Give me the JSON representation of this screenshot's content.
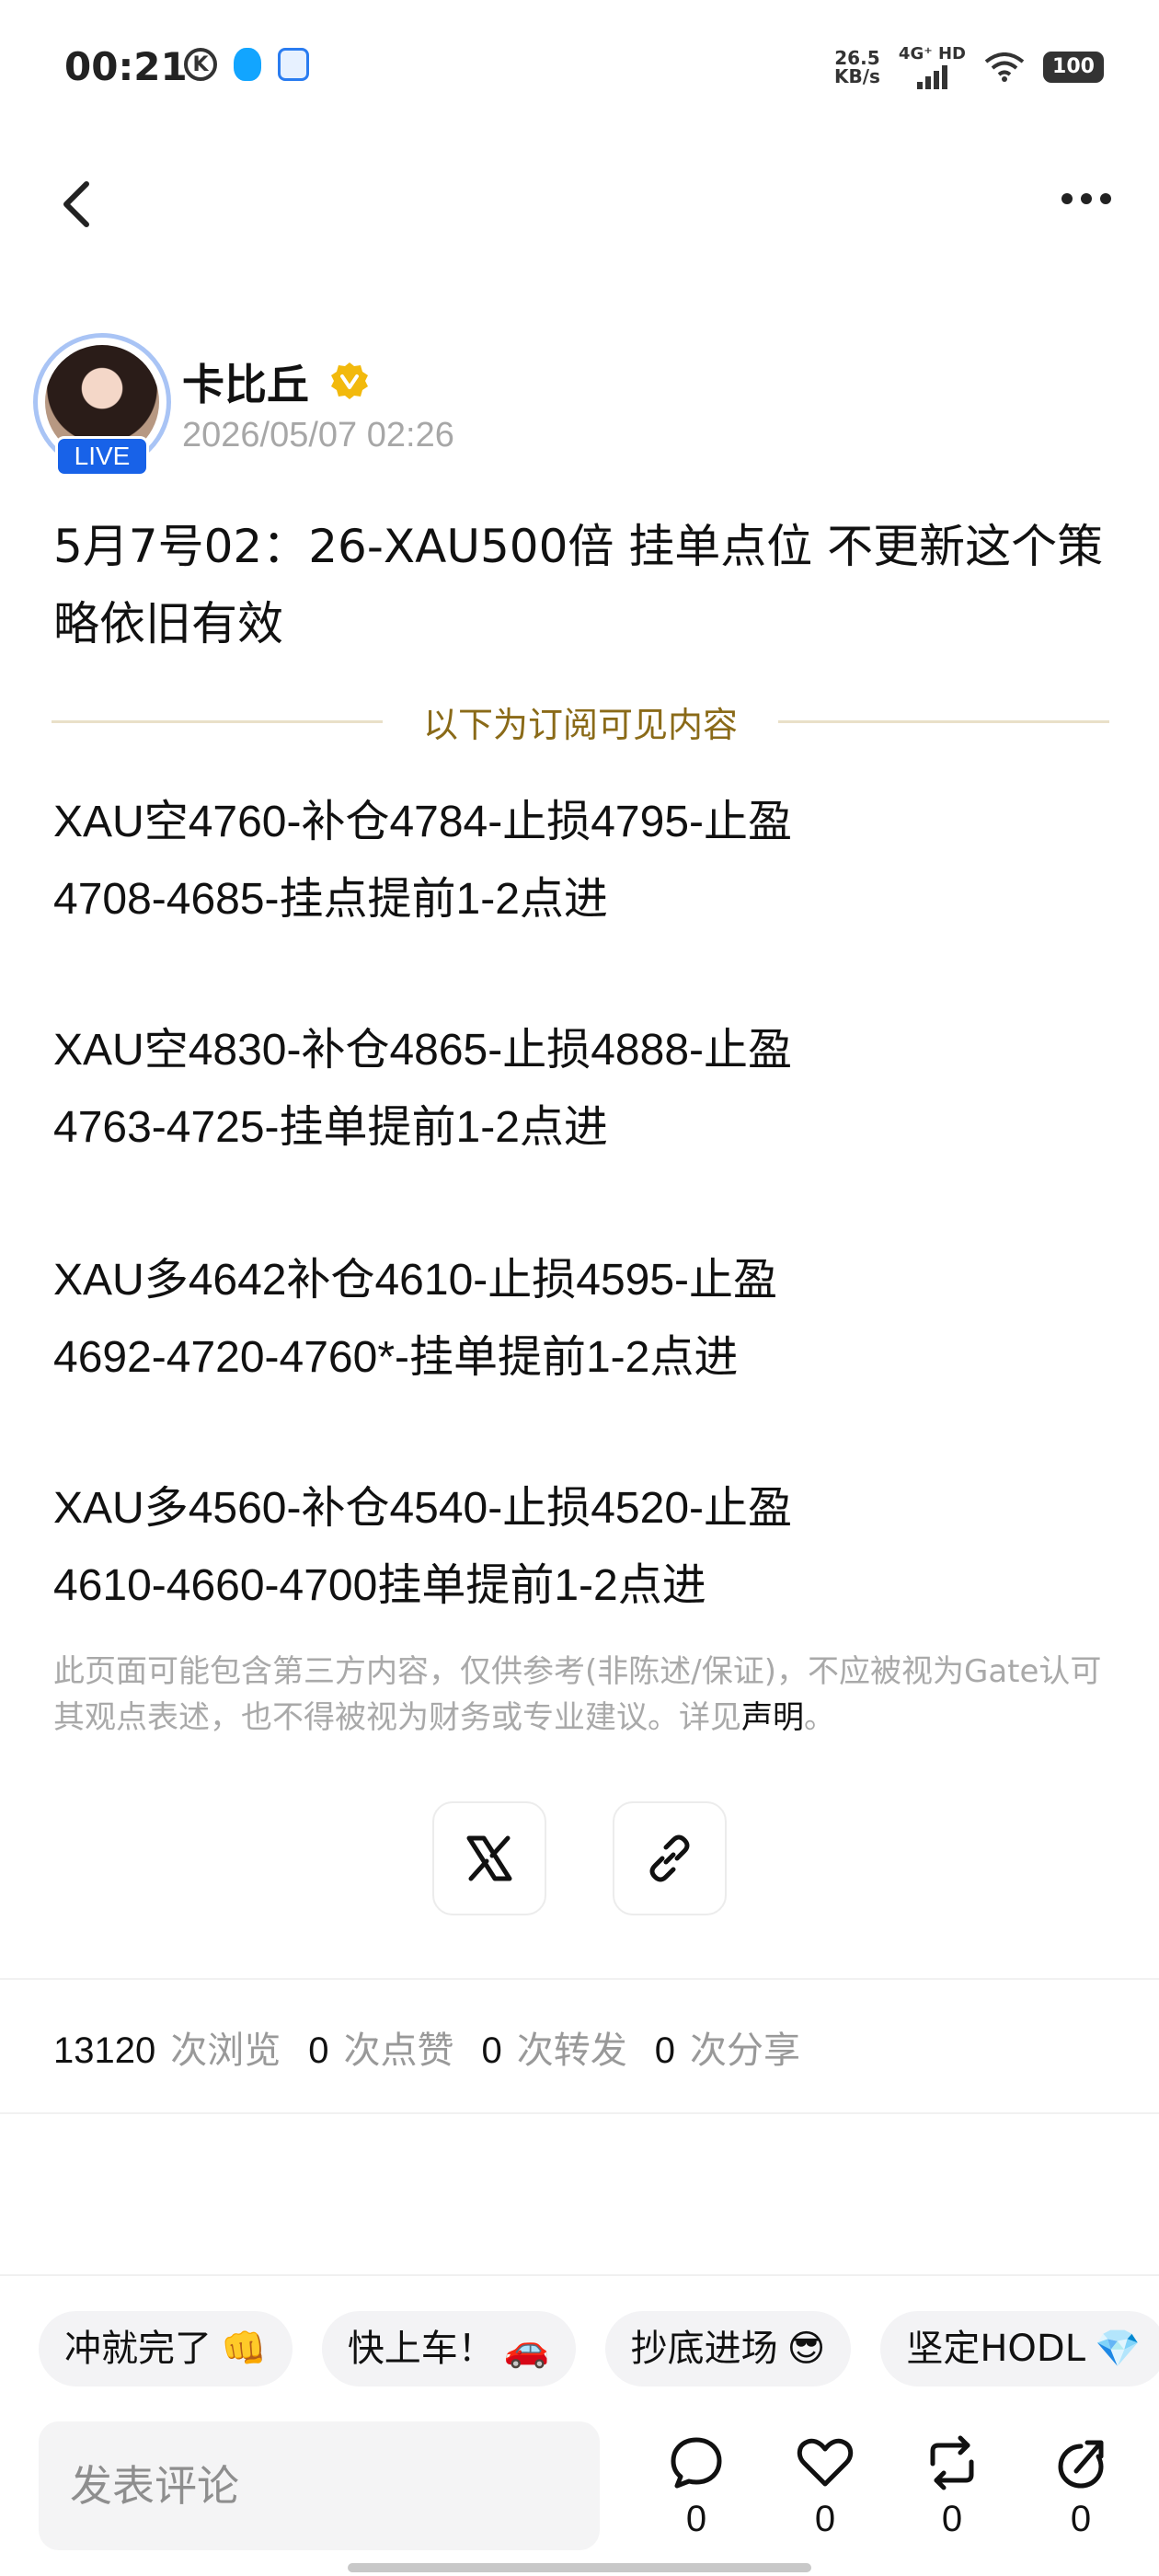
{
  "status_bar": {
    "time": "00:21",
    "speed_value": "26.5",
    "speed_unit": "KB/s",
    "network": "4G⁺ HD",
    "battery": "100"
  },
  "author": {
    "name": "卡比丘",
    "live_label": "LIVE",
    "timestamp": "2026/05/07 02:26"
  },
  "post": {
    "title": "5月7号02：26-XAU500倍 挂单点位 不更新这个策略依旧有效",
    "subscription_divider": "以下为订阅可见内容",
    "strategies": [
      {
        "line1": "XAU空4760-补仓4784-止损4795-止盈",
        "line2": "4708-4685-挂点提前1-2点进"
      },
      {
        "line1": "XAU空4830-补仓4865-止损4888-止盈",
        "line2": "4763-4725-挂单提前1-2点进"
      },
      {
        "line1": "XAU多4642补仓4610-止损4595-止盈",
        "line2": "4692-4720-4760*-挂单提前1-2点进"
      },
      {
        "line1": "XAU多4560-补仓4540-止损4520-止盈",
        "line2": "4610-4660-4700挂单提前1-2点进"
      }
    ],
    "disclaimer": "此页面可能包含第三方内容，仅供参考(非陈述/保证)，不应被视为Gate认可其观点表述，也不得被视为财务或专业建议。详见",
    "disclaimer_link": "声明",
    "disclaimer_end": "。"
  },
  "stats": {
    "views": "13120",
    "views_label": "次浏览",
    "likes": "0",
    "likes_label": "次点赞",
    "reposts": "0",
    "reposts_label": "次转发",
    "shares": "0",
    "shares_label": "次分享"
  },
  "quick_replies": [
    {
      "text": "冲就完了",
      "emoji": "👊"
    },
    {
      "text": "快上车！",
      "emoji": "🚗"
    },
    {
      "text": "抄底进场",
      "emoji": "😎"
    },
    {
      "text": "坚定HODL",
      "emoji": "💎"
    }
  ],
  "comment": {
    "placeholder": "发表评论"
  },
  "actions": {
    "comments": "0",
    "likes": "0",
    "reposts": "0",
    "shares": "0"
  },
  "colors": {
    "accent_blue": "#1862e8",
    "gold": "#8a6a18",
    "verified": "#f2b90c"
  }
}
